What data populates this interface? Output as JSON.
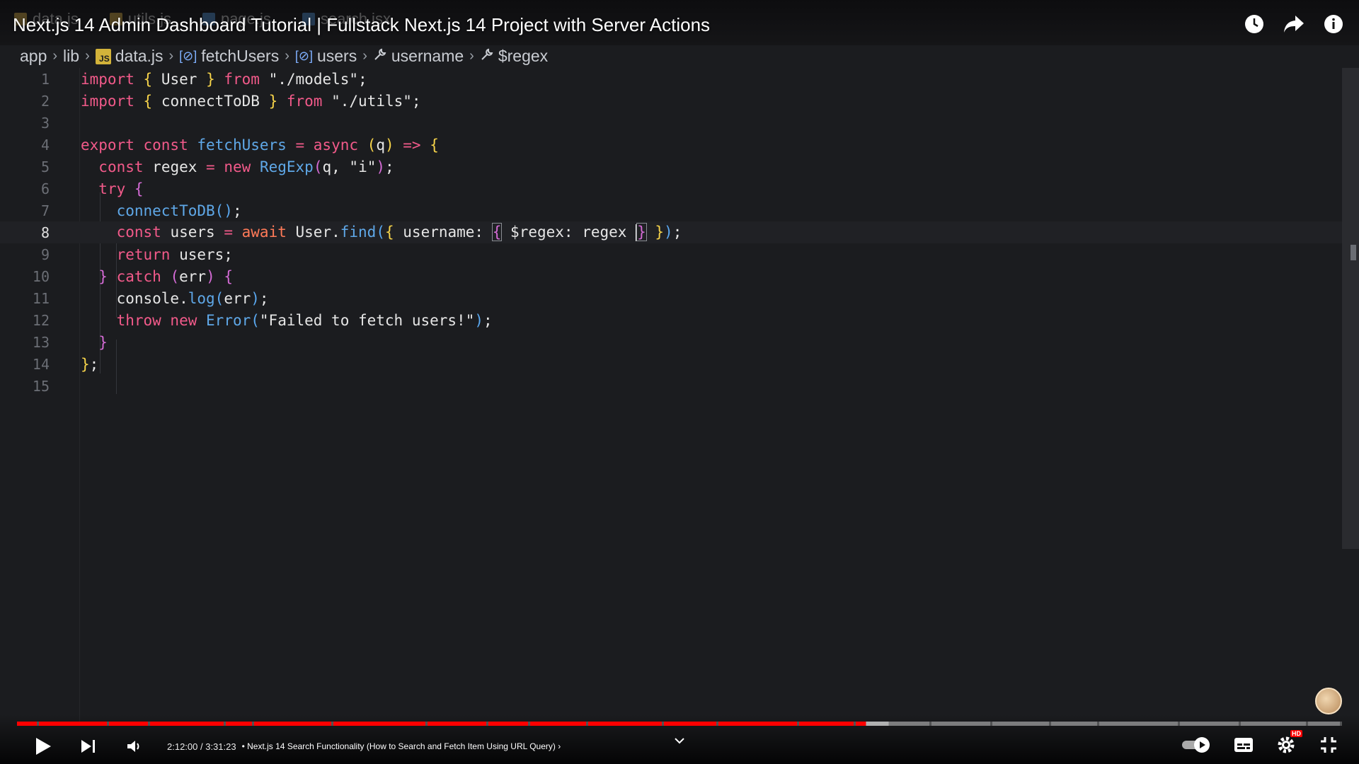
{
  "video": {
    "title": "Next.js 14 Admin Dashboard Tutorial | Fullstack Next.js 14 Project with Server Actions",
    "time": "2:12:00 / 3:31:23",
    "chapter": "• Next.js 14 Search Functionality (How to Search and Fetch Item Using URL Query)",
    "progress": 0.641,
    "buffered": 0.658,
    "hd_badge": "HD"
  },
  "faded_tabs": [
    "data.js",
    "utils.js",
    "page.js",
    "search.jsx"
  ],
  "breadcrumb": {
    "items": [
      "app",
      "lib",
      "data.js",
      "fetchUsers",
      "users",
      "username",
      "$regex"
    ],
    "js_badge": "JS"
  },
  "editor": {
    "active_line": 8,
    "line_numbers": [
      "1",
      "2",
      "3",
      "4",
      "5",
      "6",
      "7",
      "8",
      "9",
      "10",
      "11",
      "12",
      "13",
      "14",
      "15"
    ]
  },
  "icons": {
    "top": [
      "watch-later-icon",
      "share-icon",
      "info-icon"
    ],
    "controls": [
      "play-icon",
      "next-icon",
      "volume-icon",
      "autoplay-toggle-icon",
      "subtitles-icon",
      "settings-icon",
      "exit-fullscreen-icon"
    ]
  },
  "colors": {
    "progress_played": "#ff0000",
    "keyword": "#f25a8a",
    "function": "#5fa8e8",
    "brace_yellow": "#f7d44a",
    "brace_pink": "#d56bd6"
  }
}
